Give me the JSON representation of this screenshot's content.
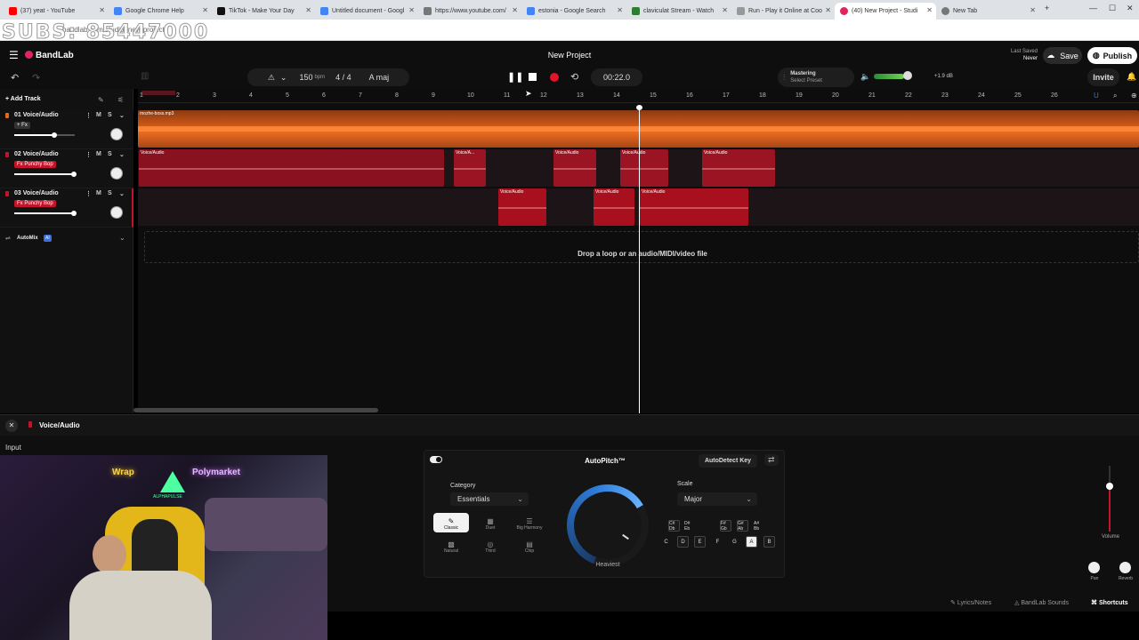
{
  "browser": {
    "tabs": [
      {
        "label": "(37) yeat - YouTube",
        "color": "#ff0000"
      },
      {
        "label": "Google Chrome Help",
        "color": "#4285f4"
      },
      {
        "label": "TikTok - Make Your Day",
        "color": "#111111"
      },
      {
        "label": "Untitled document - Googl",
        "color": "#4285f4"
      },
      {
        "label": "https://www.youtube.com/",
        "color": "#777777"
      },
      {
        "label": "estonia - Google Search",
        "color": "#4285f4"
      },
      {
        "label": "claviculat Stream - Watch",
        "color": "#2e7d32"
      },
      {
        "label": "Run - Play it Online at Coo",
        "color": "#999999"
      },
      {
        "label": "(40) New Project - Studi",
        "color": "#e0245e",
        "active": true
      },
      {
        "label": "New Tab",
        "color": "#777777"
      }
    ],
    "url": "bandlab.com/studio?new project",
    "watermark": "SUBS: 85447000"
  },
  "header": {
    "logo": "BandLab",
    "project_title": "New Project",
    "last_saved_label": "Last Saved",
    "last_saved_value": "Never",
    "save_label": "Save",
    "publish_label": "Publish"
  },
  "toolbar": {
    "bpm_value": "150",
    "bpm_unit": "bpm",
    "time_signature": "4 / 4",
    "key": "A maj",
    "time_display": "00:22.0",
    "mastering_label": "Mastering",
    "mastering_preset": "Select Preset",
    "master_db": "+1.9 dB",
    "invite_label": "Invite",
    "add_track_label": "Add Track"
  },
  "ruler": [
    "1",
    "2",
    "3",
    "4",
    "5",
    "6",
    "7",
    "8",
    "9",
    "10",
    "11",
    "12",
    "13",
    "14",
    "15",
    "16",
    "17",
    "18",
    "19",
    "20",
    "21",
    "22",
    "23",
    "24",
    "25",
    "26"
  ],
  "tracks": [
    {
      "number": "01",
      "name": "Voice/Audio",
      "fx": "+ Fx",
      "fader_level": 0.66,
      "color": "#e8691a"
    },
    {
      "number": "02",
      "name": "Voice/Audio",
      "fx": "Fx Punchy Bop",
      "fader_level": 0.99,
      "color": "#c0152a"
    },
    {
      "number": "03",
      "name": "Voice/Audio",
      "fx": "Fx Punchy Bop",
      "fader_level": 0.99,
      "color": "#c0152a"
    }
  ],
  "clips": {
    "track1_file": "mozhe-boss.mp3",
    "track2": [
      "Voice/Audio",
      "Voice/A...",
      "Voice/Audio",
      "Voice/Audio",
      "Voice/Audio"
    ],
    "track3": [
      "Voice/Audio",
      "Voice/Audio",
      "Voice/Audio"
    ]
  },
  "automix": {
    "label": "AutoMix",
    "badge": "AI"
  },
  "dropzone_text": "Drop a loop or an audio/MIDI/video file",
  "panel": {
    "track_name": "Voice/Audio",
    "input_label": "Input",
    "effect_title": "AutoPitch™",
    "autodetect_label": "AutoDetect Key",
    "category_label": "Category",
    "category_value": "Essentials",
    "categories": [
      "Classic",
      "Duet",
      "Big Harmony",
      "Natural",
      "Third",
      "Chip"
    ],
    "knob_label": "Heaviest",
    "scale_label": "Scale",
    "scale_value": "Major",
    "notes_sharp": [
      "C# Db",
      "D# Eb",
      "F# Gb",
      "G# Ab",
      "A# Bb"
    ],
    "notes": [
      "C",
      "D",
      "E",
      "F",
      "G",
      "A",
      "B"
    ],
    "volume_label": "Volume",
    "pan_label": "Pan",
    "reverb_label": "Reverb"
  },
  "webcam": {
    "sign_left": "Wrap",
    "sign_right": "Polymarket",
    "sign_center": "ALPHAPULSE"
  },
  "footer": {
    "lyrics_label": "Lyrics/Notes",
    "sounds_label": "BandLab Sounds",
    "shortcuts_label": "Shortcuts"
  }
}
